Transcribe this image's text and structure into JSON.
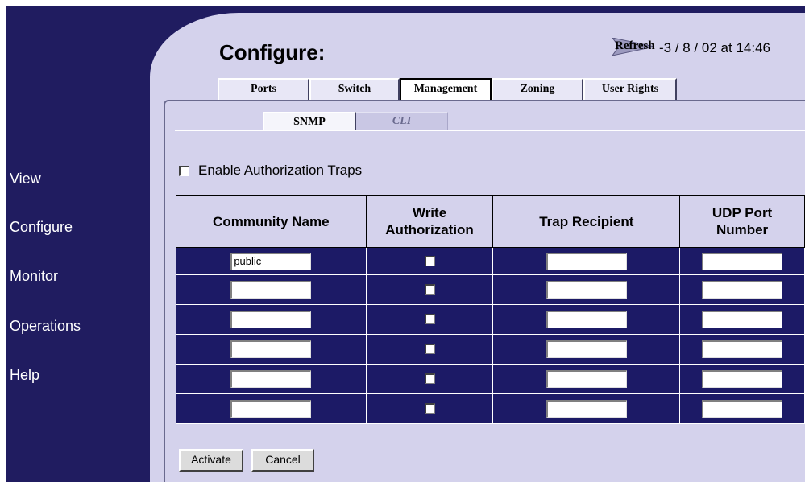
{
  "nav": {
    "items": [
      {
        "label": "View"
      },
      {
        "label": "Configure"
      },
      {
        "label": "Monitor"
      },
      {
        "label": "Operations"
      },
      {
        "label": "Help"
      }
    ]
  },
  "header": {
    "title": "Configure:",
    "refresh_label": "Refresh",
    "timestamp": "-3 / 8 / 02 at 14:46"
  },
  "tabs": [
    {
      "label": "Ports"
    },
    {
      "label": "Switch"
    },
    {
      "label": "Management",
      "active": true
    },
    {
      "label": "Zoning"
    },
    {
      "label": "User Rights"
    }
  ],
  "subtabs": [
    {
      "label": "SNMP",
      "active": true
    },
    {
      "label": "CLI"
    }
  ],
  "enable_traps": {
    "label": "Enable Authorization Traps",
    "checked": false
  },
  "table": {
    "headers": [
      "Community Name",
      "Write",
      "Authorization",
      "Trap Recipient",
      "UDP Port",
      "Number"
    ],
    "rows": [
      {
        "community": "public",
        "write": false,
        "recipient": "",
        "port": ""
      },
      {
        "community": "",
        "write": false,
        "recipient": "",
        "port": ""
      },
      {
        "community": "",
        "write": false,
        "recipient": "",
        "port": ""
      },
      {
        "community": "",
        "write": false,
        "recipient": "",
        "port": ""
      },
      {
        "community": "",
        "write": false,
        "recipient": "",
        "port": ""
      },
      {
        "community": "",
        "write": false,
        "recipient": "",
        "port": ""
      }
    ]
  },
  "buttons": {
    "activate": "Activate",
    "cancel": "Cancel"
  },
  "colors": {
    "sidebar": "#201c60",
    "panel": "#d4d2ec",
    "table_row": "#1c1a66"
  }
}
